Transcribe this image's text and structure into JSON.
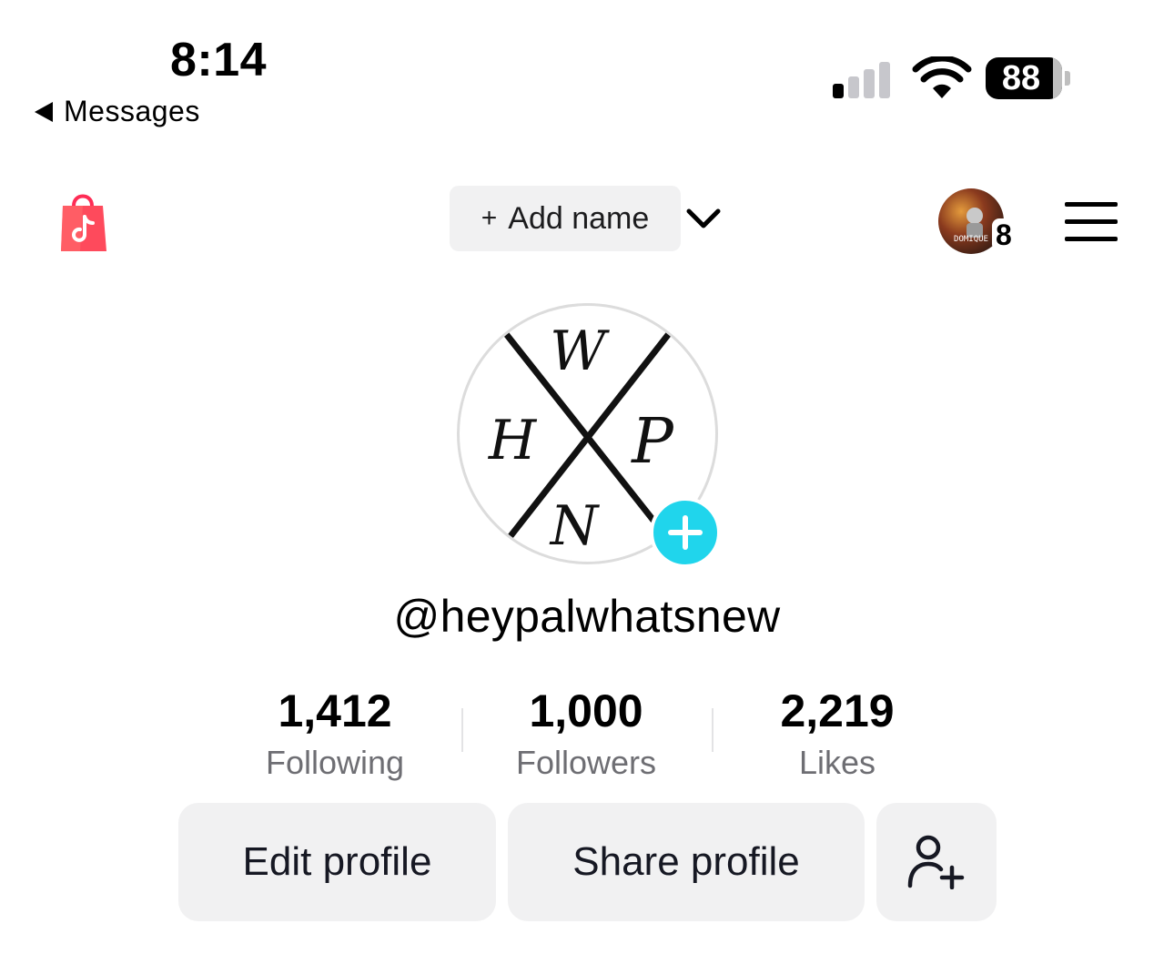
{
  "status_bar": {
    "time": "8:14",
    "back_label": "Messages",
    "battery": "88"
  },
  "top_nav": {
    "add_name_plus": "+",
    "add_name_label": "Add name",
    "story_count": "8",
    "story_avatar_text": "DOMIQUE"
  },
  "profile": {
    "username": "@heypalwhatsnew",
    "avatar_letters": [
      "W",
      "H",
      "P",
      "N"
    ]
  },
  "stats": [
    {
      "value": "1,412",
      "label": "Following"
    },
    {
      "value": "1,000",
      "label": "Followers"
    },
    {
      "value": "2,219",
      "label": "Likes"
    }
  ],
  "actions": {
    "edit_profile": "Edit profile",
    "share_profile": "Share profile"
  },
  "colors": {
    "accent_cyan": "#20d5ec",
    "shop_red": "#fe2c55",
    "button_bg": "#f1f1f2",
    "secondary_text": "#6e6e73"
  },
  "icons": [
    "back-arrow-icon",
    "signal-icon",
    "wifi-icon",
    "battery-icon",
    "shop-bag-icon",
    "chevron-down-icon",
    "menu-icon",
    "plus-icon",
    "add-friend-icon"
  ]
}
